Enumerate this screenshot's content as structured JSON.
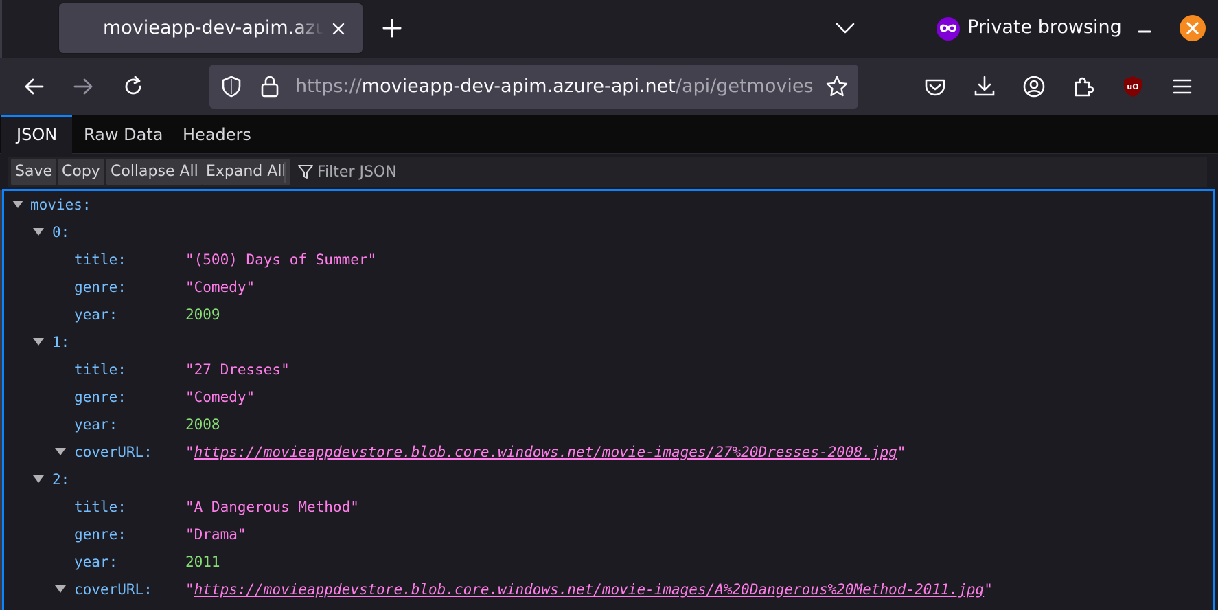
{
  "browser": {
    "tab_title": "movieapp-dev-apim.azure-api.net/api/getmovies",
    "private_label": "Private browsing"
  },
  "urlbar": {
    "scheme": "https://",
    "host": "movieapp-dev-apim.azure-api.net",
    "path": "/api/getmovies"
  },
  "viewer_tabs": [
    "JSON",
    "Raw Data",
    "Headers"
  ],
  "toolbar": {
    "save": "Save",
    "copy": "Copy",
    "collapse_all": "Collapse All",
    "expand_all": "Expand All",
    "filter_placeholder": "Filter JSON"
  },
  "json": {
    "root_key": "movies:",
    "items": [
      {
        "index": "0:",
        "title": "\"(500) Days of Summer\"",
        "genre": "\"Comedy\"",
        "year": "2009"
      },
      {
        "index": "1:",
        "title": "\"27 Dresses\"",
        "genre": "\"Comedy\"",
        "year": "2008",
        "coverURL": "https://movieappdevstore.blob.core.windows.net/movie-images/27%20Dresses-2008.jpg"
      },
      {
        "index": "2:",
        "title": "\"A Dangerous Method\"",
        "genre": "\"Drama\"",
        "year": "2011",
        "coverURL": "https://movieappdevstore.blob.core.windows.net/movie-images/A%20Dangerous%20Method-2011.jpg"
      }
    ],
    "labels": {
      "title": "title:",
      "genre": "genre:",
      "year": "year:",
      "coverURL": "coverURL:"
    }
  },
  "colors": {
    "accent": "#0a84ff",
    "key": "#75bfff",
    "string": "#ff7de9",
    "number": "#86de74",
    "close_button": "#f48a20",
    "private_icon": "#8000d7"
  }
}
